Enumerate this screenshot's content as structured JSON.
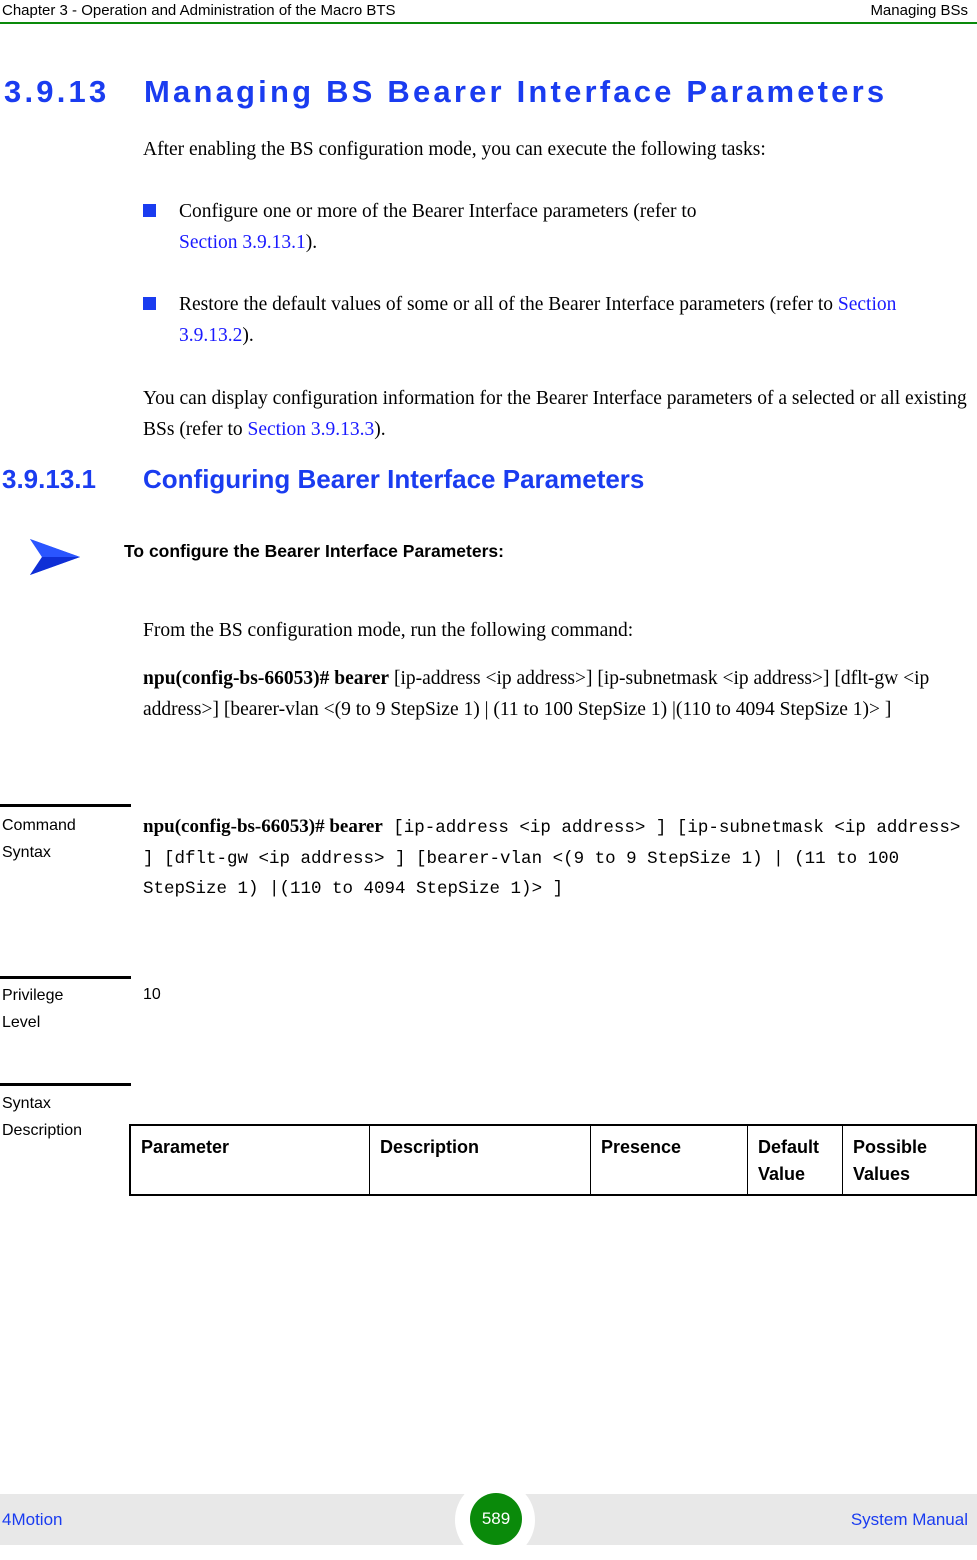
{
  "header": {
    "chapter": "Chapter 3 - Operation and Administration of the Macro BTS",
    "section": "Managing BSs"
  },
  "section_heading": {
    "number": "3.9.13",
    "title": "Managing BS Bearer Interface Parameters"
  },
  "intro": "After enabling the BS configuration mode, you can execute the following tasks:",
  "bullets": [
    {
      "text_before": "Configure one or more of the Bearer Interface parameters (refer to",
      "link": "Section 3.9.13.1",
      "text_after": ")."
    },
    {
      "text_before": "Restore the default values of some or all of the Bearer Interface parameters (refer to",
      "link": "Section 3.9.13.2",
      "text_after": ")."
    }
  ],
  "display_note": {
    "text_before": "You can display configuration information for the Bearer Interface parameters of a selected or all existing BSs (refer to",
    "link": "Section 3.9.13.3",
    "text_after": ")."
  },
  "subsection_heading": {
    "number": "3.9.13.1",
    "title": "Configuring Bearer Interface Parameters"
  },
  "procedure_title": "To configure the Bearer Interface Parameters:",
  "run_command_intro": "From the BS configuration mode, run the following command:",
  "command_line": {
    "prompt": "npu(config-bs-66053)# bearer",
    "args": " [ip-address <ip address>] [ip-subnetmask <ip address>] [dflt-gw <ip address>]  [bearer-vlan <(9 to 9 StepSize 1) | (11 to 100 StepSize 1) |(110 to 4094 StepSize 1)> ]"
  },
  "command_syntax": {
    "label": "Command Syntax",
    "prompt": "npu(config-bs-66053)# bearer",
    "args": " [ip-address <ip address> ] [ip-subnetmask <ip address> ] [dflt-gw <ip address> ] [bearer-vlan <(9 to 9 StepSize 1) | (11 to 100 StepSize 1) |(110 to 4094 StepSize 1)> ]"
  },
  "privilege_level": {
    "label": "Privilege Level",
    "value": "10"
  },
  "syntax_description": {
    "label": "Syntax Description",
    "columns": [
      "Parameter",
      "Description",
      "Presence",
      "Default Value",
      "Possible Values"
    ]
  },
  "footer": {
    "product": "4Motion",
    "page_number": "589",
    "manual": "System Manual"
  }
}
